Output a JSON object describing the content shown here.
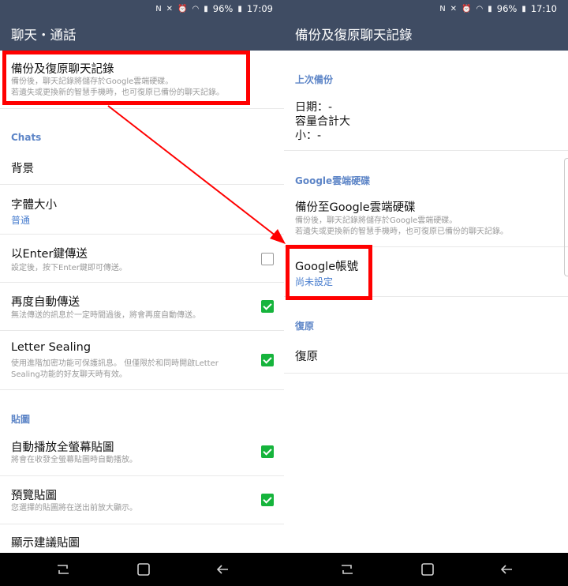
{
  "left": {
    "status_time": "17:09",
    "battery": "96%",
    "appbar_title": "聊天・通話",
    "backup_row": {
      "title": "備份及復原聊天記錄",
      "desc1": "備份後，聊天記錄將儲存於Google雲端硬碟。",
      "desc2": "若遺失或更換新的智慧手機時，也可復原已備份的聊天記錄。"
    },
    "chats_header": "Chats",
    "background_label": "背景",
    "font_size": {
      "title": "字體大小",
      "value": "普通"
    },
    "enter_send": {
      "title": "以Enter鍵傳送",
      "desc": "設定後，按下Enter鍵即可傳送。",
      "checked": false
    },
    "auto_resend": {
      "title": "再度自動傳送",
      "desc": "無法傳送的訊息於一定時間過後，將會再度自動傳送。",
      "checked": true
    },
    "letter_sealing": {
      "title": "Letter Sealing",
      "desc1": "使用進階加密功能可保護訊息。 但僅限於和同時開啟Letter",
      "desc2": "Sealing功能的好友聊天時有效。",
      "checked": true
    },
    "stickers_header": "貼圖",
    "auto_play": {
      "title": "自動播放全螢幕貼圖",
      "desc": "將會在收發全螢幕貼圖時自動播放。",
      "checked": true
    },
    "preview": {
      "title": "預覽貼圖",
      "desc": "您選擇的貼圖將在送出前放大顯示。",
      "checked": true
    },
    "suggest": {
      "title": "顯示建議貼圖"
    }
  },
  "right": {
    "status_time": "17:10",
    "battery": "96%",
    "appbar_title": "備份及復原聊天記錄",
    "last_backup_header": "上次備份",
    "date_line": "日期：-",
    "size_line1": "容量合計大",
    "size_line2": "小：-",
    "drive_header": "Google雲端硬碟",
    "backup_to_drive": {
      "title": "備份至Google雲端硬碟",
      "desc1": "備份後，聊天記錄將儲存於Google雲端硬碟。",
      "desc2": "若遺失或更換新的智慧手機時，也可復原已備份的聊天記錄。"
    },
    "google_account": {
      "title": "Google帳號",
      "value": "尚未設定"
    },
    "restore_header": "復原",
    "restore_label": "復原"
  },
  "colors": {
    "appbar": "#3f4c63",
    "accent_blue": "#4b7fcf",
    "check_green": "#16b43c",
    "highlight": "#ff0000"
  },
  "icons": [
    "nfc-icon",
    "mute-icon",
    "alarm-icon",
    "wifi-icon",
    "signal-icon",
    "battery-icon",
    "recent-apps-icon",
    "home-icon",
    "back-icon"
  ]
}
